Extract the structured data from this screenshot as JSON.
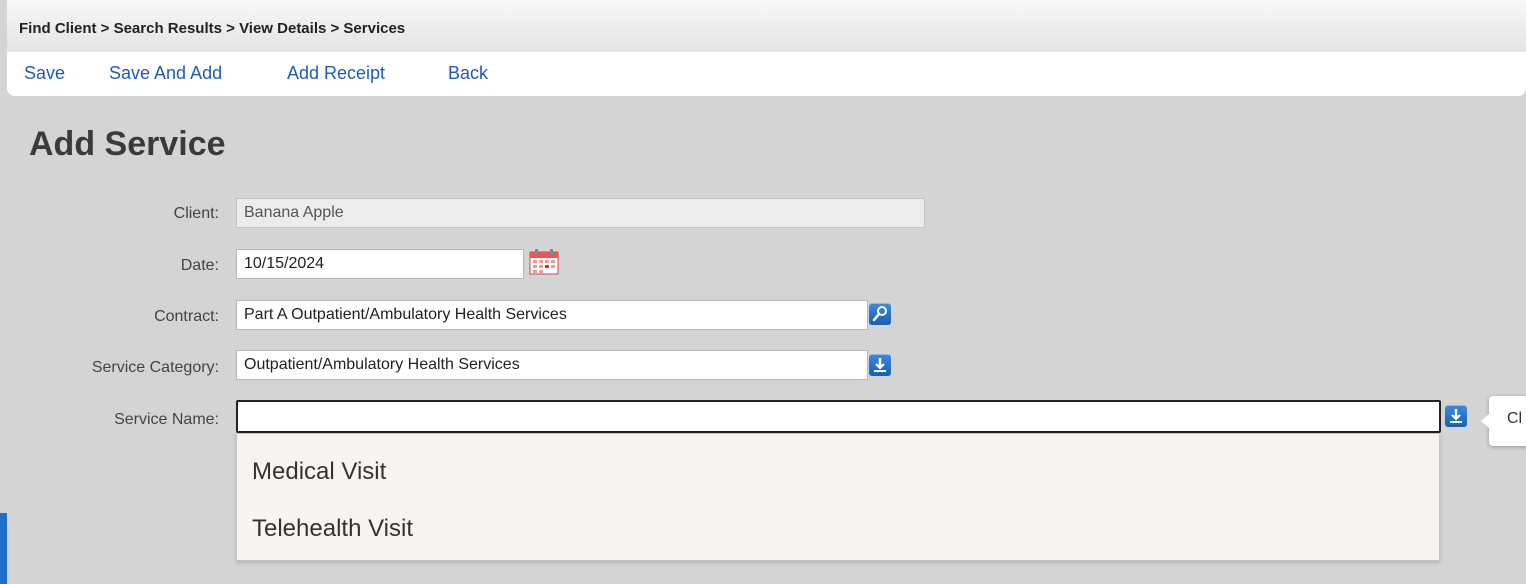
{
  "breadcrumb": "Find Client > Search Results > View Details > Services",
  "toolbar": {
    "save": "Save",
    "save_and_add": "Save And Add",
    "add_receipt": "Add Receipt",
    "back": "Back"
  },
  "page_title": "Add Service",
  "form": {
    "client": {
      "label": "Client:",
      "value": "Banana Apple"
    },
    "date": {
      "label": "Date:",
      "value": "10/15/2024"
    },
    "contract": {
      "label": "Contract:",
      "value": "Part A Outpatient/Ambulatory Health Services"
    },
    "service_category": {
      "label": "Service Category:",
      "value": "Outpatient/Ambulatory Health Services"
    },
    "service_name": {
      "label": "Service Name:",
      "value": ""
    }
  },
  "dropdown": {
    "options": [
      "Medical Visit",
      "Telehealth Visit"
    ]
  },
  "tooltip_text": "Cl",
  "icons": {
    "calendar": "calendar-icon",
    "contract_lookup": "search-icon",
    "category_dropdown": "download-arrow-icon",
    "service_dropdown": "download-arrow-icon"
  },
  "colors": {
    "link": "#1f5bb8",
    "icon_button": "#1a5fb0",
    "background": "#d4d4d4"
  }
}
